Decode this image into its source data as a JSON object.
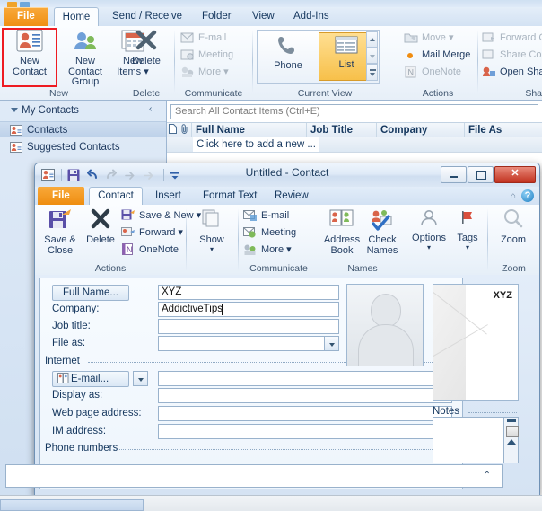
{
  "main_window": {
    "tabs": [
      {
        "label": "File",
        "id": "file"
      },
      {
        "label": "Home",
        "id": "home"
      },
      {
        "label": "Send / Receive",
        "id": "send-receive"
      },
      {
        "label": "Folder",
        "id": "folder"
      },
      {
        "label": "View",
        "id": "view"
      },
      {
        "label": "Add-Ins",
        "id": "add-ins"
      }
    ],
    "ribbon": {
      "groups": [
        {
          "name": "New",
          "label": "New"
        },
        {
          "name": "Delete",
          "label": "Delete"
        },
        {
          "name": "Communicate",
          "label": "Communicate"
        },
        {
          "name": "Current View",
          "label": "Current View"
        },
        {
          "name": "Actions",
          "label": "Actions"
        },
        {
          "name": "Share",
          "label": "Sha"
        }
      ],
      "new_contact": "New\nContact",
      "new_contact_l1": "New",
      "new_contact_l2": "Contact",
      "new_contact_group_l1": "New Contact",
      "new_contact_group_l2": "Group",
      "new_items_l1": "New",
      "new_items_l2": "Items ▾",
      "delete": "Delete",
      "email": "E-mail",
      "meeting": "Meeting",
      "more": "More ▾",
      "phone": "Phone",
      "list": "List",
      "move": "Move ▾",
      "mail_merge": "Mail Merge",
      "onenote": "OneNote",
      "forward_contact": "Forward C",
      "share_contacts": "Share Con",
      "open_shared": "Open Shar"
    }
  },
  "nav_pane": {
    "header": "My Contacts",
    "items": [
      {
        "label": "Contacts",
        "selected": true
      },
      {
        "label": "Suggested Contacts",
        "selected": false
      }
    ]
  },
  "list_pane": {
    "search_placeholder": "Search All Contact Items (Ctrl+E)",
    "columns": [
      "Full Name",
      "Job Title",
      "Company",
      "File As"
    ],
    "new_row_text": "Click here to add a new ..."
  },
  "contact_dialog": {
    "title": "Untitled  -  Contact",
    "window_buttons": [
      "minimize",
      "maximize",
      "close"
    ],
    "quick_access": [
      "contact-icon",
      "save-icon",
      "undo-icon",
      "redo-icon",
      "previous-icon",
      "next-icon",
      "customize-icon"
    ],
    "tabs": [
      {
        "label": "File",
        "id": "file"
      },
      {
        "label": "Contact",
        "id": "contact"
      },
      {
        "label": "Insert",
        "id": "insert"
      },
      {
        "label": "Format Text",
        "id": "format-text"
      },
      {
        "label": "Review",
        "id": "review"
      }
    ],
    "help_label": "?",
    "ribbon": {
      "groups": [
        {
          "label": "Actions"
        },
        {
          "label": ""
        },
        {
          "label": "Communicate"
        },
        {
          "label": "Names"
        },
        {
          "label": ""
        },
        {
          "label": "Zoom"
        }
      ],
      "save_close_l1": "Save &",
      "save_close_l2": "Close",
      "delete": "Delete",
      "save_new": "Save & New ▾",
      "forward": "Forward ▾",
      "onenote": "OneNote",
      "show": "Show",
      "email": "E-mail",
      "meeting": "Meeting",
      "more": "More ▾",
      "address_book_l1": "Address",
      "address_book_l2": "Book",
      "check_names_l1": "Check",
      "check_names_l2": "Names",
      "options": "Options",
      "tags": "Tags",
      "zoom": "Zoom",
      "group_actions": "Actions",
      "group_communicate": "Communicate",
      "group_names": "Names",
      "group_zoom": "Zoom"
    },
    "form": {
      "full_name_button": "Full Name...",
      "full_name_value": "XYZ",
      "company_label": "Company:",
      "company_value": "AddictiveTips",
      "job_title_label": "Job title:",
      "job_title_value": "",
      "file_as_label": "File as:",
      "file_as_value": "",
      "internet_section": "Internet",
      "email_button": "E-mail...",
      "email_value": "",
      "display_as_label": "Display as:",
      "display_as_value": "",
      "web_page_label": "Web page address:",
      "web_page_value": "",
      "im_address_label": "IM address:",
      "im_address_value": "",
      "phone_section": "Phone numbers",
      "notes_label": "Notes",
      "card_name": "XYZ"
    }
  },
  "colors": {
    "file_tab_orange": "#ef8f13",
    "highlight_red": "#ee1b22",
    "selected_gallery": "#fcd575",
    "close_button_red": "#c1321f",
    "text_blue": "#15375e"
  }
}
